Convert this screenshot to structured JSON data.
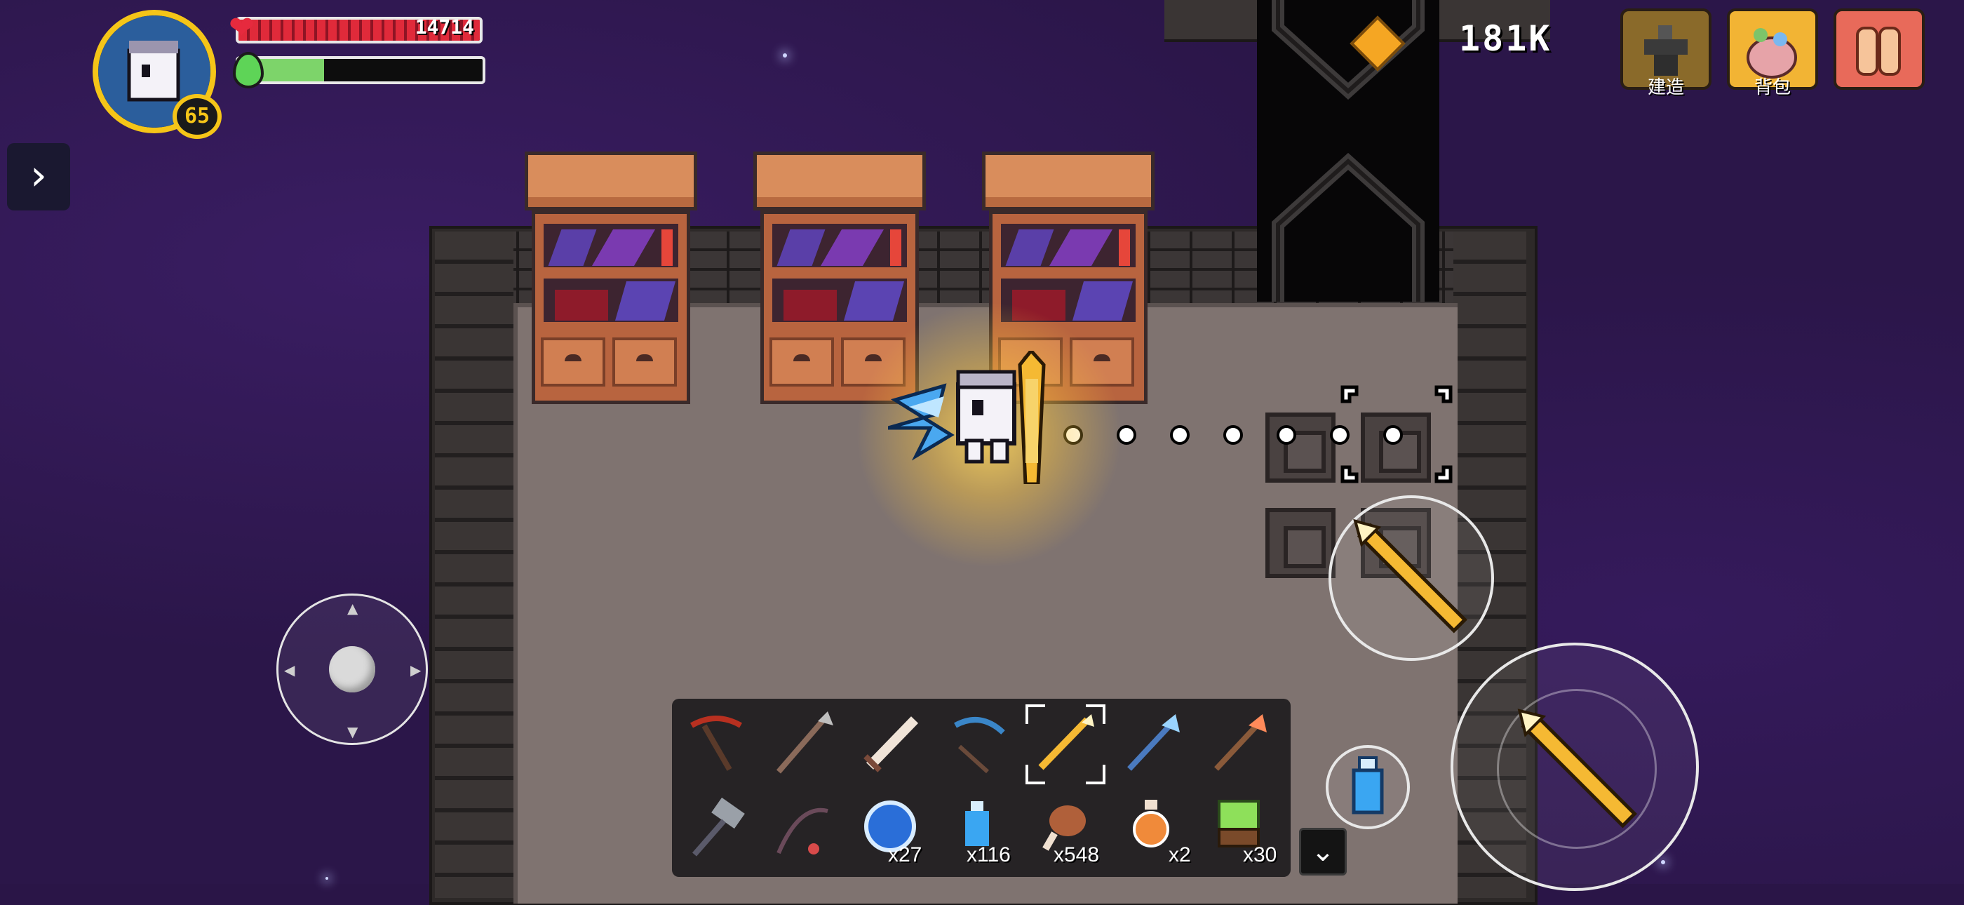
{
  "hud": {
    "hp_text": "14714",
    "hp_fraction": 1.0,
    "mp_fraction": 0.35,
    "level": "65",
    "gem_count": "181K"
  },
  "menu": {
    "build_label": "建造",
    "bag_label": "背包"
  },
  "hotbar": {
    "row1": [
      "crossbow-pickaxe",
      "spear",
      "sword",
      "bow",
      "golden-spear",
      "ice-staff",
      "fire-staff"
    ],
    "selected_index": 4,
    "row2": [
      {
        "item": "hammer",
        "qty": ""
      },
      {
        "item": "fishing-rod",
        "qty": ""
      },
      {
        "item": "blue-orb",
        "qty": "x27"
      },
      {
        "item": "blue-potion",
        "qty": "x116"
      },
      {
        "item": "meat",
        "qty": "x548"
      },
      {
        "item": "orange-potion",
        "qty": "x2"
      },
      {
        "item": "grass-block",
        "qty": "x30"
      }
    ]
  },
  "colors": {
    "hp": "#e02a3a",
    "mp": "#7dd46a",
    "gold": "#f5c518",
    "space": "#2b1649"
  }
}
